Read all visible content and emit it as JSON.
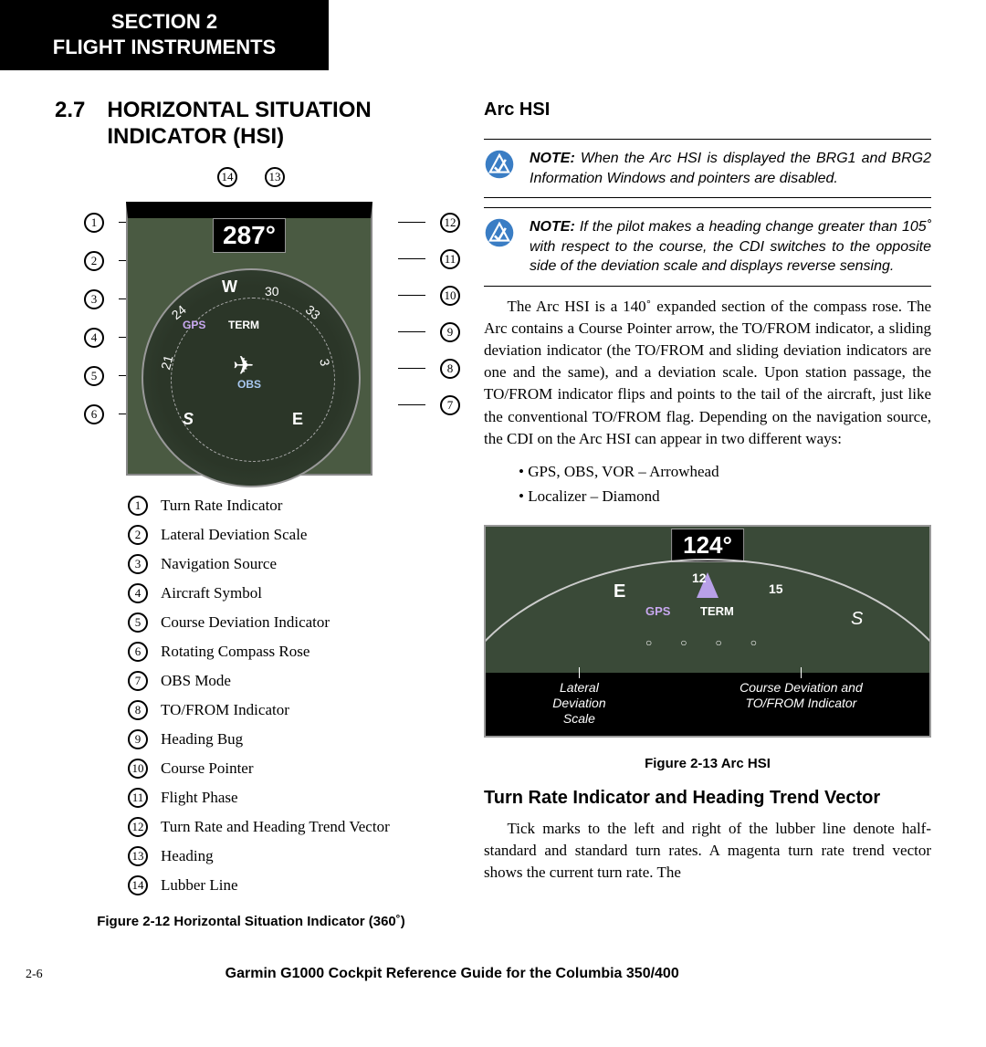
{
  "section_header": {
    "line1": "SECTION 2",
    "line2": "FLIGHT INSTRUMENTS"
  },
  "heading": {
    "number": "2.7",
    "title": "HORIZONTAL SITUATION INDICATOR (HSI)"
  },
  "hsi_figure": {
    "heading_value": "287°",
    "labels": {
      "gps": "GPS",
      "term": "TERM",
      "obs": "OBS",
      "w": "W",
      "c30": "30",
      "c33": "33",
      "c24": "24",
      "c21": "21",
      "s": "S",
      "e": "E",
      "c3": "3"
    },
    "callouts_top": [
      "14",
      "13"
    ],
    "callouts_left": [
      "1",
      "2",
      "3",
      "4",
      "5",
      "6"
    ],
    "callouts_right": [
      "12",
      "11",
      "10",
      "9",
      "8",
      "7"
    ]
  },
  "legend": [
    {
      "n": "1",
      "t": "Turn Rate Indicator"
    },
    {
      "n": "2",
      "t": "Lateral Deviation Scale"
    },
    {
      "n": "3",
      "t": "Navigation Source"
    },
    {
      "n": "4",
      "t": "Aircraft Symbol"
    },
    {
      "n": "5",
      "t": "Course Deviation Indicator"
    },
    {
      "n": "6",
      "t": "Rotating Compass Rose"
    },
    {
      "n": "7",
      "t": "OBS Mode"
    },
    {
      "n": "8",
      "t": "TO/FROM Indicator"
    },
    {
      "n": "9",
      "t": "Heading Bug"
    },
    {
      "n": "10",
      "t": "Course Pointer"
    },
    {
      "n": "11",
      "t": "Flight Phase"
    },
    {
      "n": "12",
      "t": "Turn Rate and Heading Trend Vector"
    },
    {
      "n": "13",
      "t": "Heading"
    },
    {
      "n": "14",
      "t": "Lubber Line"
    }
  ],
  "fig_left_caption": "Figure 2-12  Horizontal Situation Indicator (360˚)",
  "right": {
    "arc_heading": "Arc HSI",
    "note1_label": "NOTE:",
    "note1": "When the Arc HSI is displayed the BRG1 and BRG2 Information Windows and pointers are disabled.",
    "note2_label": "NOTE:",
    "note2": "If the pilot makes a heading change greater than 105˚ with respect to the course, the CDI switches to the opposite side of the deviation scale and displays reverse sensing.",
    "para": "The Arc HSI is a 140˚ expanded section of the compass rose.  The Arc contains a Course Pointer arrow, the TO/FROM indicator, a sliding deviation indicator (the TO/FROM and sliding deviation indicators are one and the same), and a deviation scale.  Upon station passage, the TO/FROM indicator flips and points to the tail of the aircraft, just like the conventional TO/FROM flag.  Depending on the navigation source, the CDI on the Arc HSI can appear in two different ways:",
    "bullets": [
      "GPS, OBS, VOR – Arrowhead",
      "Localizer – Diamond"
    ],
    "arc_fig": {
      "heading_value": "124°",
      "labels": {
        "c12": "12",
        "e": "E",
        "c15": "15",
        "s": "S",
        "gps": "GPS",
        "term": "TERM"
      },
      "annot_left": "Lateral\nDeviation\nScale",
      "annot_right": "Course Deviation and\nTO/FROM Indicator",
      "caption": "Figure 2-13  Arc HSI"
    },
    "sub2": "Turn Rate Indicator and Heading Trend Vector",
    "para2": "Tick marks to the left and right of the lubber line denote half-standard and standard turn rates.  A magenta turn rate trend vector shows the current turn rate.  The"
  },
  "footer": {
    "page": "2-6",
    "title": "Garmin G1000 Cockpit Reference Guide for the Columbia 350/400"
  }
}
